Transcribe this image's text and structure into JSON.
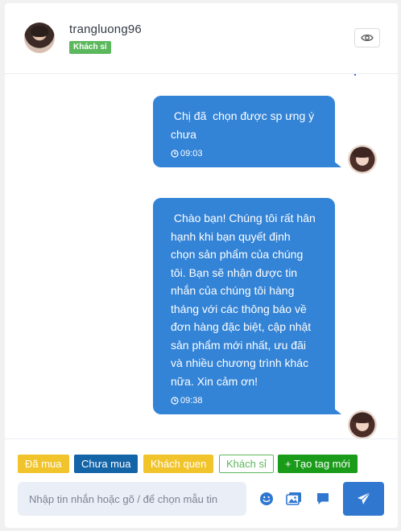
{
  "header": {
    "username": "trangluong96",
    "role_badge": "Khách sỉ"
  },
  "messages": [
    {
      "text": " Chị đã  chọn được sp ưng ý chưa",
      "time": "09:03"
    },
    {
      "text": " Chào bạn! Chúng tôi rất hân hạnh khi bạn quyết định chọn sản phẩm của chúng tôi. Bạn sẽ nhận được tin nhắn của chúng tôi hàng tháng với các thông báo về đơn hàng đặc biệt, cập nhật sản phẩm mới nhất, ưu đãi và nhiều chương trình khác nữa. Xin cảm ơn!",
      "time": "09:38"
    }
  ],
  "tags": [
    "Đã mua",
    "Chưa mua",
    "Khách quen",
    "Khách sỉ",
    "+ Tạo tag mới"
  ],
  "composer": {
    "placeholder": "Nhập tin nhắn hoặc gõ / để chọn mẫu tin"
  },
  "colors": {
    "bubble": "#3383d6",
    "send_button": "#3077d0",
    "badge_green": "#5cb85c",
    "tag_yellow": "#f2c42c",
    "tag_blue": "#1464a8",
    "tag_create": "#1a9c1a"
  },
  "icons": {
    "visibility": "eye-icon",
    "clock": "clock-icon",
    "emoji": "smile-icon",
    "image": "images-icon",
    "template": "chat-bubble-icon",
    "send": "paper-plane-icon"
  }
}
